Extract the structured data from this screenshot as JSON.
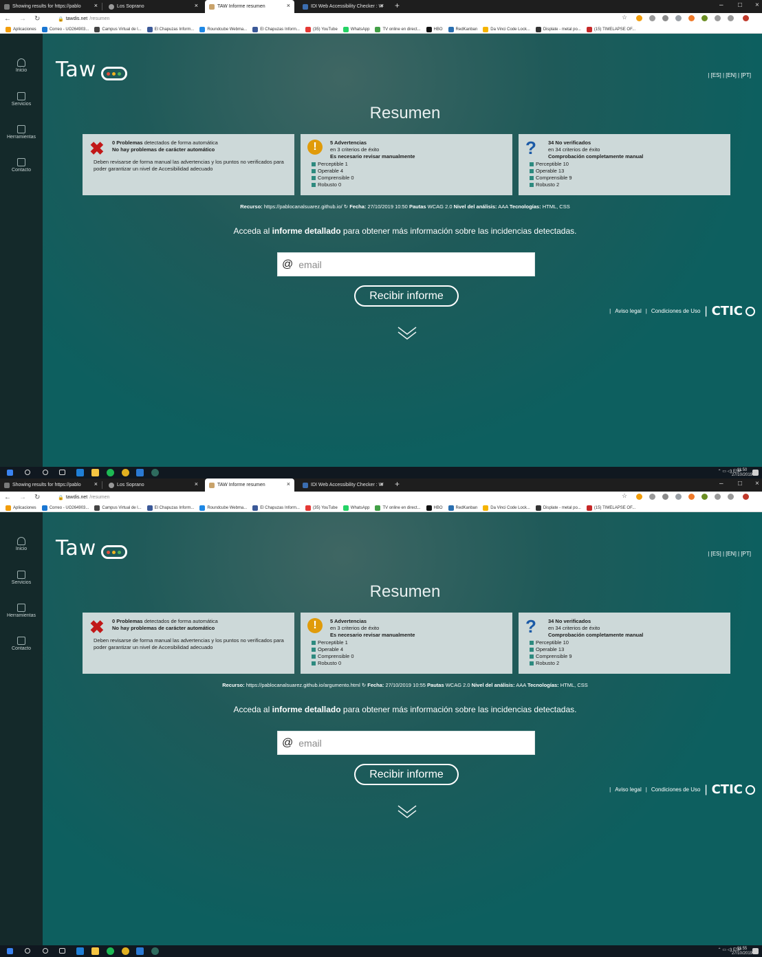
{
  "shots": [
    {
      "tabs": [
        {
          "label": "Showing results for https://pablo"
        },
        {
          "label": "Los Soprano"
        },
        {
          "label": "TAW Informe resumen"
        },
        {
          "label": "IDI Web Accessibility Checker : W"
        }
      ],
      "address": {
        "domain": "tawdis.net",
        "path": "/resumen"
      },
      "bookmarks": [
        "Aplicaciones",
        "Correo - UO264903...",
        "Campus Virtual de l...",
        "El Chapuzas Inform...",
        "Roundcube Webma...",
        "El Chapuzas Inform...",
        "(35) YouTube",
        "WhatsApp",
        "TV online en direct...",
        "HBO",
        "RedKanban",
        "Da Vinci Code Lock...",
        "Displate - metal po...",
        "(15) TIMELAPSE OF..."
      ],
      "sidebar": [
        "Inicio",
        "Servicios",
        "Herramientas",
        "Contacto"
      ],
      "logo": "Taw",
      "langs": "| [ES] | [EN] | [PT]",
      "title": "Resumen",
      "card1": {
        "count_label": "0 Problemas",
        "count_suffix": " detectados de forma automática",
        "headline": "No hay problemas de carácter automático",
        "para": "Deben revisarse de forma manual las advertencias y los puntos no verificados para poder garantizar un nivel de Accesibilidad adecuado"
      },
      "card2": {
        "count_label": "5 Advertencias",
        "sub": "en 3 criterios de éxito",
        "headline": "Es necesario revisar manualmente",
        "crits": [
          "Perceptible 1",
          "Operable 4",
          "Comprensible 0",
          "Robusto 0"
        ]
      },
      "card3": {
        "count_label": "34 No verificados",
        "sub": "en 34 criterios de éxito",
        "headline": "Comprobación completamente manual",
        "crits": [
          "Perceptible 10",
          "Operable 13",
          "Comprensible 9",
          "Robusto 2"
        ]
      },
      "resource": {
        "label": "Recurso:",
        "url": "https://pablocanalsuarez.github.io/",
        "date_label": "Fecha:",
        "date": "27/10/2019 10:50",
        "rules_label": "Pautas",
        "rules": "WCAG 2.0",
        "level_label": "Nivel del análisis:",
        "level": "AAA",
        "tech_label": "Tecnologías:",
        "tech": "HTML, CSS"
      },
      "access": {
        "pre": "Acceda al ",
        "bold": "informe detallado",
        "post": " para obtener más información sobre las incidencias detectadas."
      },
      "email_placeholder": "email",
      "button": "Recibir informe",
      "footer": {
        "legal": "Aviso legal",
        "terms": "Condiciones de Uso",
        "brand": "CTIC"
      },
      "tray": {
        "lang": "ESP",
        "time": "11:50",
        "date": "27/10/2019"
      }
    },
    {
      "tabs": [
        {
          "label": "Showing results for https://pablo"
        },
        {
          "label": "Los Soprano"
        },
        {
          "label": "TAW Informe resumen"
        },
        {
          "label": "IDI Web Accessibility Checker : W"
        }
      ],
      "address": {
        "domain": "tawdis.net",
        "path": "/resumen"
      },
      "bookmarks": [
        "Aplicaciones",
        "Correo - UO264903...",
        "Campus Virtual de l...",
        "El Chapuzas Inform...",
        "Roundcube Webma...",
        "El Chapuzas Inform...",
        "(35) YouTube",
        "WhatsApp",
        "TV online en direct...",
        "HBO",
        "RedKanban",
        "Da Vinci Code Lock...",
        "Displate - metal po...",
        "(15) TIMELAPSE OF..."
      ],
      "sidebar": [
        "Inicio",
        "Servicios",
        "Herramientas",
        "Contacto"
      ],
      "logo": "Taw",
      "langs": "| [ES] | [EN] | [PT]",
      "title": "Resumen",
      "card1": {
        "count_label": "0 Problemas",
        "count_suffix": " detectados de forma automática",
        "headline": "No hay problemas de carácter automático",
        "para": "Deben revisarse de forma manual las advertencias y los puntos no verificados para poder garantizar un nivel de Accesibilidad adecuado"
      },
      "card2": {
        "count_label": "5 Advertencias",
        "sub": "en 3 criterios de éxito",
        "headline": "Es necesario revisar manualmente",
        "crits": [
          "Perceptible 1",
          "Operable 4",
          "Comprensible 0",
          "Robusto 0"
        ]
      },
      "card3": {
        "count_label": "34 No verificados",
        "sub": "en 34 criterios de éxito",
        "headline": "Comprobación completamente manual",
        "crits": [
          "Perceptible 10",
          "Operable 13",
          "Comprensible 9",
          "Robusto 2"
        ]
      },
      "resource": {
        "label": "Recurso:",
        "url": "https://pablocanalsuarez.github.io/argumento.html",
        "date_label": "Fecha:",
        "date": "27/10/2019 10:55",
        "rules_label": "Pautas",
        "rules": "WCAG 2.0",
        "level_label": "Nivel del análisis:",
        "level": "AAA",
        "tech_label": "Tecnologías:",
        "tech": "HTML, CSS"
      },
      "access": {
        "pre": "Acceda al ",
        "bold": "informe detallado",
        "post": " para obtener más información sobre las incidencias detectadas."
      },
      "email_placeholder": "email",
      "button": "Recibir informe",
      "footer": {
        "legal": "Aviso legal",
        "terms": "Condiciones de Uso",
        "brand": "CTIC"
      },
      "tray": {
        "lang": "ESP",
        "time": "11:55",
        "date": "27/10/2019"
      }
    }
  ],
  "colors": {
    "page_bg": "#0c5f5f",
    "sidebar_bg": "#14292a",
    "card_bg": "#cdd9d9",
    "error_red": "#c11818",
    "warning_orange": "#e09b0a",
    "info_blue": "#1b5aa6"
  },
  "icons": [
    "home-icon",
    "briefcase-icon",
    "tools-icon",
    "mail-icon",
    "error-x-icon",
    "warning-icon",
    "question-icon",
    "chevron-down-icon",
    "refresh-icon",
    "lock-icon",
    "star-icon"
  ]
}
